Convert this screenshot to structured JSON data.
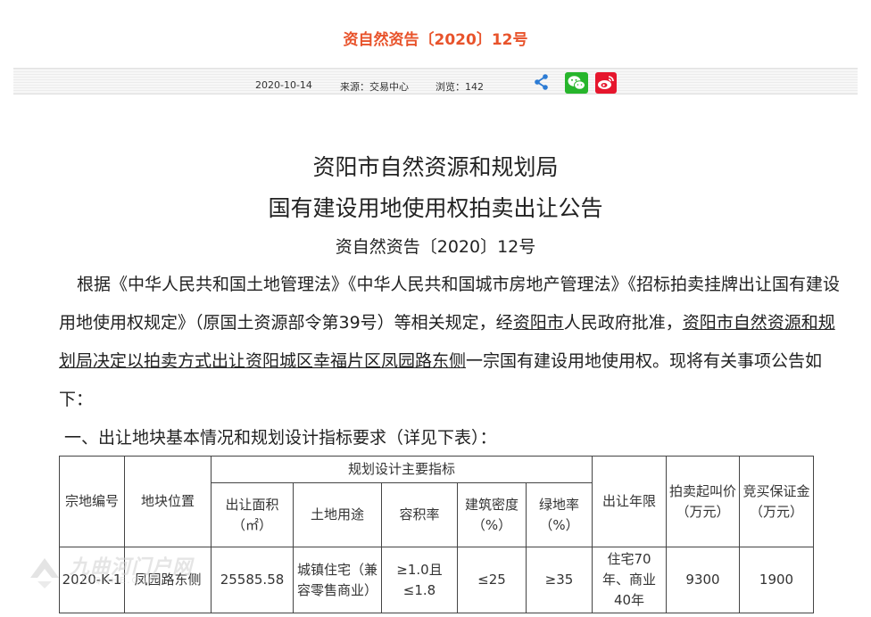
{
  "header": {
    "title": "资自然资告〔2020〕12号",
    "date": "2020-10-14",
    "source": "来源：交易中心",
    "views": "浏览：142"
  },
  "share": {
    "icons": [
      "share-icon",
      "wechat-icon",
      "weibo-icon"
    ],
    "colors": {
      "wechat": "#27b52c",
      "weibo": "#e6162d",
      "share": "#2b7bd4"
    }
  },
  "article": {
    "title_line1": "资阳市自然资源和规划局",
    "title_line2": "国有建设用地使用权拍卖出让公告",
    "doc_number": "资自然资告〔2020〕12号",
    "para1_a": "根据《中华人民共和国土地管理法》《中华人民共和国城市房地产管理法》《招标拍卖挂牌出让国有建设用地使用权规定》（原国土资源部令第39号）等相关规定，经",
    "para1_link1": "资阳市",
    "para1_b": "人民政府批准，",
    "para1_link2": "资阳市自然资源和规划局决定以拍卖方式出让资阳城区幸福片区凤园路东侧",
    "para1_c": "一宗国有建设用地使用权。现将有关事项公告如下：",
    "section1": "一、出让地块基本情况和规划设计指标要求（详见下表）："
  },
  "table": {
    "headers": {
      "parcel_no": "宗地编号",
      "location": "地块位置",
      "planning": "规划设计主要指标",
      "term": "出让年限",
      "start_price": "拍卖起叫价（万元）",
      "deposit": "竞买保证金（万元）"
    },
    "subheaders": {
      "area": "出让面积（㎡）",
      "use": "土地用途",
      "far": "容积率",
      "density": "建筑密度（%）",
      "green": "绿地率（%）"
    },
    "row": {
      "parcel_no": "2020-K-1",
      "location": "凤园路东侧",
      "area": "25585.58",
      "use": "城镇住宅（兼容零售商业）",
      "far": "≥1.0且≤1.8",
      "density": "≤25",
      "green": "≥35",
      "term": "住宅70年、商业40年",
      "start_price": "9300",
      "deposit": "1900"
    }
  },
  "watermark": {
    "text": "九曲河门户网",
    "sub": "JIUQUHE.COM"
  },
  "colors": {
    "title_accent": "#e8532b",
    "link": "#222222"
  }
}
